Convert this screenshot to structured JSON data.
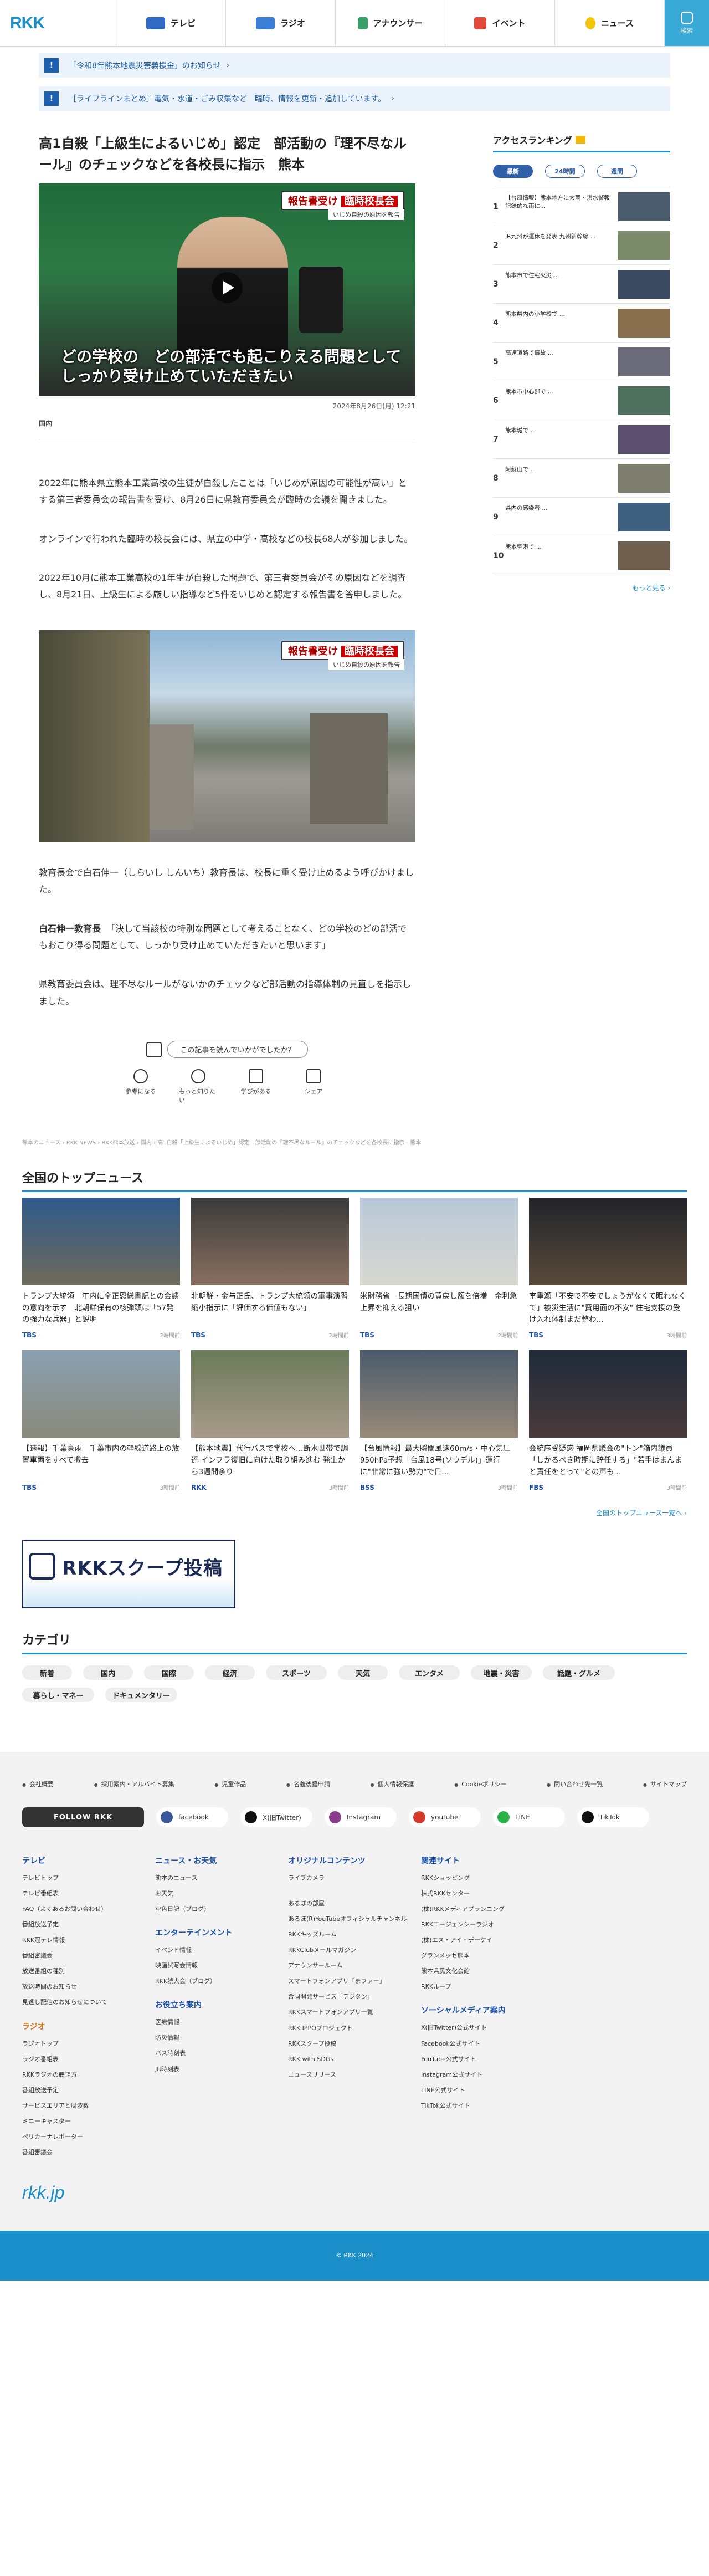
{
  "header": {
    "logo": "RKK",
    "nav": [
      {
        "label": "テレビ",
        "icon": "tv-icon"
      },
      {
        "label": "ラジオ",
        "icon": "radio-icon"
      },
      {
        "label": "アナウンサー",
        "icon": "announcer-icon"
      },
      {
        "label": "イベント",
        "icon": "event-icon"
      },
      {
        "label": "ニュース",
        "icon": "news-icon"
      }
    ],
    "search_label": "検索"
  },
  "notices": [
    {
      "text": "「令和8年熊本地震災害義援金」のお知らせ"
    },
    {
      "text": "［ライフラインまとめ］電気・水道・ごみ収集など　臨時、情報を更新・追加しています。"
    }
  ],
  "article": {
    "title": "高1自殺「上級生によるいじめ」認定　部活動の『理不尽なルール』のチェックなどを各校長に指示　熊本",
    "video_board": "報告書受け",
    "video_board_tag": "臨時校長会",
    "video_sub": "いじめ自殺の原因を報告",
    "video_caption_1": "どの学校の　どの部活でも起こりえる問題として",
    "video_caption_2": "しっかり受け止めていただきたい",
    "date": "2024年8月26日(月) 12:21",
    "category": "国内",
    "paragraphs": [
      "2022年に熊本県立熊本工業高校の生徒が自殺したことは「いじめが原因の可能性が高い」とする第三者委員会の報告書を受け、8月26日に県教育委員会が臨時の会議を開きました。",
      "オンラインで行われた臨時の校長会には、県立の中学・高校などの校長68人が参加しました。",
      "2022年10月に熊本工業高校の1年生が自殺した問題で、第三者委員会がその原因などを調査し、8月21日、上級生による厳しい指導など5件をいじめと認定する報告書を答申しました。"
    ],
    "photo_board": "報告書受け",
    "photo_board_tag": "臨時校長会",
    "photo_sub": "いじめ自殺の原因を報告",
    "after_photo": "教育長会で白石伸一（しらいし しんいち）教育長は、校長に重く受け止めるよう呼びかけました。",
    "quote_speaker": "白石伸一教育長",
    "quote_text": "「決して当該校の特別な問題として考えることなく、どの学校のどの部活でもおこり得る問題として、しっかり受け止めていただきたいと思います」",
    "closing": "県教育委員会は、理不尽なルールがないかのチェックなど部活動の指導体制の見直しを指示しました。",
    "feedback_question": "この記事を読んでいかがでしたか？",
    "feedback_buttons": [
      "参考になる",
      "もっと知りたい",
      "学びがある",
      "シェア"
    ]
  },
  "ranking": {
    "title": "アクセスランキング",
    "tabs": [
      "最新",
      "24時間",
      "週間"
    ],
    "items": [
      {
        "no": "1",
        "text": "【台風情報】熊本地方に大雨・洪水警報　記録的な雨に..."
      },
      {
        "no": "2",
        "text": "JR九州が運休を発表 九州新幹線 ..."
      },
      {
        "no": "3",
        "text": "熊本市で住宅火災 ..."
      },
      {
        "no": "4",
        "text": "熊本県内の小学校で ..."
      },
      {
        "no": "5",
        "text": "高速道路で事故 ..."
      },
      {
        "no": "6",
        "text": "熊本市中心部で ..."
      },
      {
        "no": "7",
        "text": "熊本城で ..."
      },
      {
        "no": "8",
        "text": "阿蘇山で ..."
      },
      {
        "no": "9",
        "text": "県内の感染者 ..."
      },
      {
        "no": "10",
        "text": "熊本空港で ..."
      }
    ],
    "more": "もっと見る ›"
  },
  "breadcrumb": "熊本のニュース › RKK NEWS › RKK熊本放送 › 国内 › 高1自殺「上級生によるいじめ」認定　部活動の『理不尽なルール』のチェックなどを各校長に指示　熊本",
  "top_news": {
    "title": "全国のトップニュース",
    "items": [
      {
        "text": "トランプ大統領　年内に全正恩総書記との会談の意向を示す　北朝鮮保有の核弾頭は「57発の強力な兵器」と説明",
        "src": "TBS",
        "time": "2時間前"
      },
      {
        "text": "北朝鮮・金与正氏、トランプ大統領の軍事演習縮小指示に「評価する価値もない」",
        "src": "TBS",
        "time": "2時間前"
      },
      {
        "text": "米財務省　長期国債の買戻し額を倍増　金利急上昇を抑える狙い",
        "src": "TBS",
        "time": "2時間前"
      },
      {
        "text": "李重瀬「不安で不安でしょうがなくて眠れなくて」被災生活に\"費用面の不安\" 住宅支援の受け入れ体制まだ整わ...",
        "src": "TBS",
        "time": "3時間前"
      },
      {
        "text": "【速報】千葉豪雨　千葉市内の幹線道路上の放置車両をすべて撤去",
        "src": "TBS",
        "time": "3時間前"
      },
      {
        "text": "【熊本地震】代行バスで学校へ…断水世帯で調達 インフラ復旧に向けた取り組み進む 発生から3週間余り",
        "src": "RKK",
        "time": "3時間前"
      },
      {
        "text": "【台風情報】最大瞬間風速60m/s・中心気圧950hPa予想「台風18号(ソウデル)」運行に\"非常に強い勢力\"で日...",
        "src": "BSS",
        "time": "3時間前"
      },
      {
        "text": "会統序受疑惑 福岡県議会の\"トン\"箱内議員「しかるべき時期に辞任する」\"若手はまんまと責任をとって\"との声も...",
        "src": "FBS",
        "time": "3時間前"
      }
    ],
    "more": "全国のトップニュース一覧へ ›"
  },
  "banner": {
    "text": "RKKスクープ投稿"
  },
  "categories": {
    "title": "カテゴリ",
    "items": [
      "新着",
      "国内",
      "国際",
      "経済",
      "スポーツ",
      "天気",
      "エンタメ",
      "地震・災害",
      "話題・グルメ",
      "暮らし・マネー",
      "ドキュメンタリー"
    ]
  },
  "footer": {
    "links": [
      "会社概要",
      "採用案内・アルバイト募集",
      "児童作品",
      "名義後援申請",
      "個人情報保護",
      "Cookieポリシー",
      "問い合わせ先一覧",
      "サイトマップ"
    ],
    "follow": "FOLLOW RKK",
    "sns": [
      "facebook",
      "X(旧Twitter)",
      "Instagram",
      "youtube",
      "LINE",
      "TikTok"
    ],
    "cols": [
      {
        "h": "テレビ",
        "items": [
          "テレビトップ",
          "テレビ番組表",
          "FAQ（よくあるお問い合わせ）",
          "番組放送予定",
          "RKK冠テレ情報",
          "番組審議会",
          "放送番組の種別",
          "放送時間のお知らせ",
          "見逃し配信のお知らせについて"
        ]
      },
      {
        "h": "ラジオ",
        "items": [
          "ラジオトップ",
          "ラジオ番組表",
          "RKKラジオの聴き方",
          "番組放送予定",
          "サービスエリアと周波数",
          "ミニーキャスター",
          "ペリカーナレポーター",
          "番組審議会"
        ]
      },
      {
        "h": "ニュース・お天気",
        "items": [
          "熊本のニュース",
          "お天気",
          "空色日記（ブログ）"
        ]
      },
      {
        "h": "エンターテインメント",
        "items": [
          "イベント情報",
          "映画試写会情報",
          "RKK読大会（ブログ）"
        ]
      },
      {
        "h": "お役立ち案内",
        "items": [
          "医療情報",
          "防災情報",
          "バス時刻表",
          "JR時刻表"
        ]
      },
      {
        "h": "オリジナルコンテンツ",
        "items": [
          "ライブカメラ"
        ]
      },
      {
        "h": "",
        "items": [
          "あるぼの部屋",
          "あるぼ(R)YouTubeオフィシャルチャンネル",
          "RKKキッズルーム",
          "RKKClubメールマガジン",
          "アナウンサールーム",
          "スマートフォンアプリ「まファー」",
          "合同開発サービス「デジタン」",
          "RKKスマートフォンアプリ一覧",
          "RKK IPPOプロジェクト",
          "RKKスクープ投稿",
          "RKK with SDGs",
          "ニュースリリース"
        ]
      },
      {
        "h": "関連サイト",
        "items": [
          "RKKショッピング",
          "株式RKKセンター",
          "(株)RKKメディアプランニング",
          "RKKエージェンシーラジオ",
          "(株)エス・アイ・デーケイ",
          "グランメッセ熊本",
          "熊本県民文化会館",
          "RKKループ"
        ]
      },
      {
        "h": "ソーシャルメディア案内",
        "items": [
          "X(旧Twitter)公式サイト",
          "Facebook公式サイト",
          "YouTube公式サイト",
          "Instagram公式サイト",
          "LINE公式サイト",
          "TikTok公式サイト"
        ]
      }
    ],
    "logo": "rkk.jp",
    "copyright": "© RKK 2024"
  },
  "colors": {
    "accent": "#1a8fc9",
    "notice_bg": "#eaf3fb",
    "footer_bg": "#f3f3f3"
  }
}
